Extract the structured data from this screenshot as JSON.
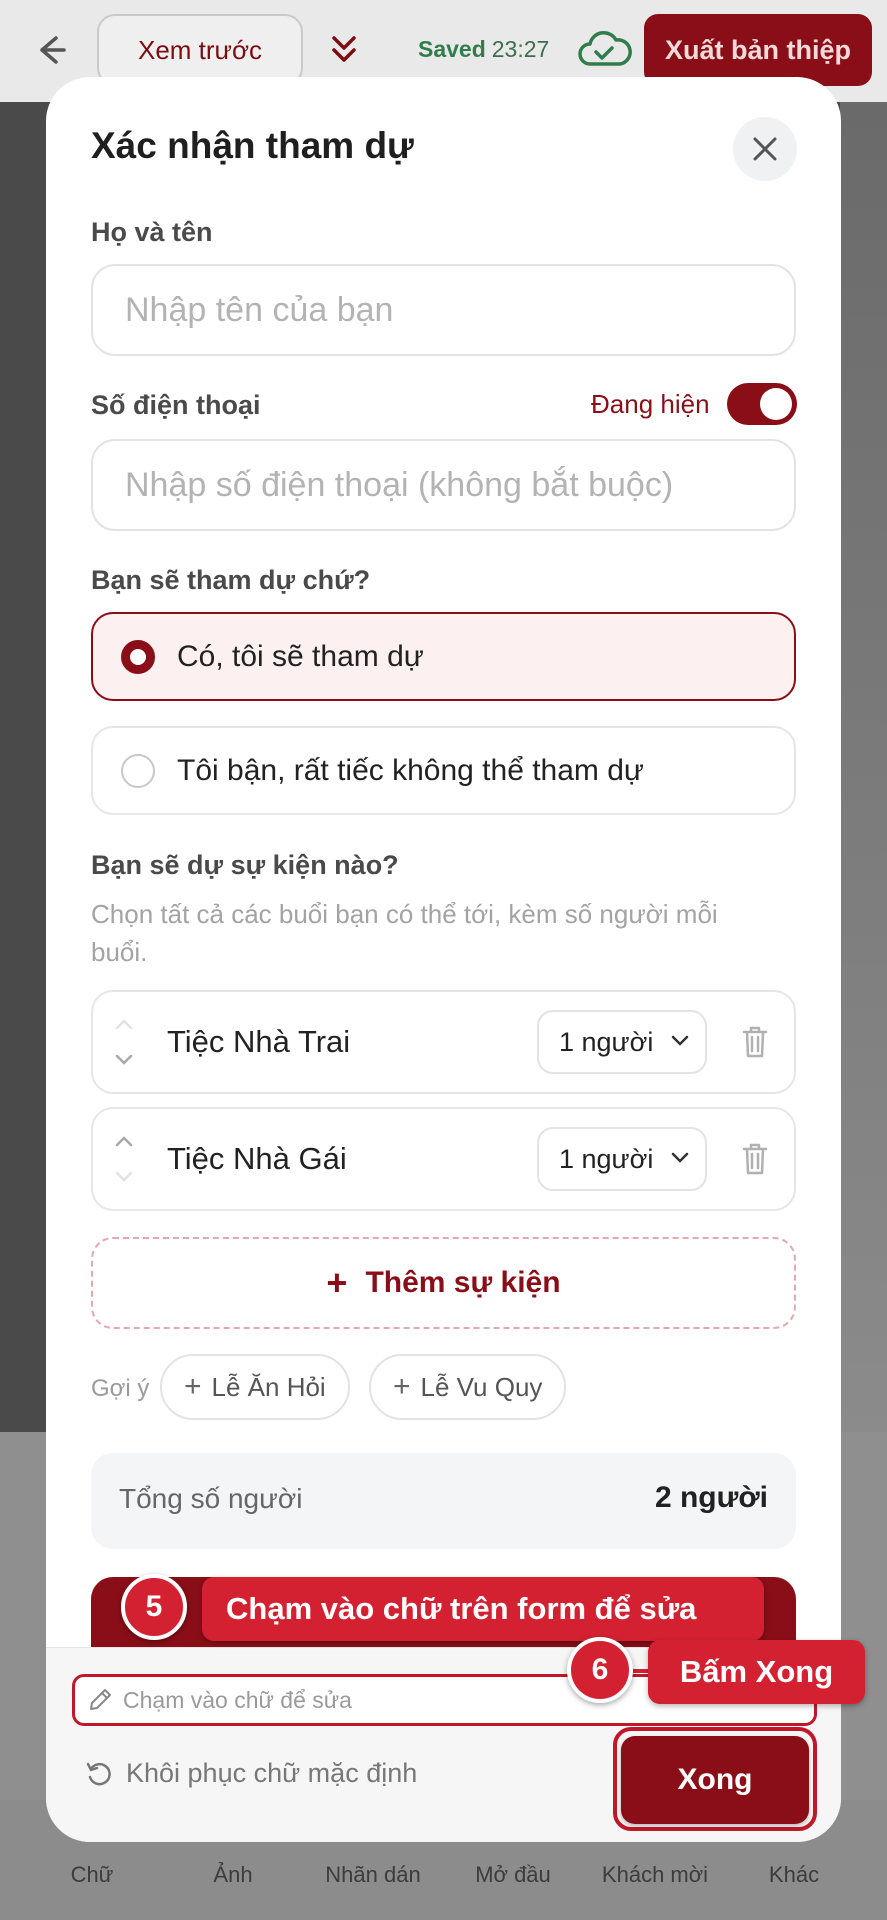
{
  "topbar": {
    "preview_label": "Xem trước",
    "saved_label": "Saved",
    "saved_time": "23:27",
    "export_label": "Xuất bản thiệp"
  },
  "bottom_nav": [
    "Chữ",
    "Ảnh",
    "Nhãn dán",
    "Mở đầu",
    "Khách mời",
    "Khác"
  ],
  "modal": {
    "title": "Xác nhận tham dự",
    "name_label": "Họ và tên",
    "name_placeholder": "Nhập tên của bạn",
    "phone_label": "Số điện thoại",
    "phone_toggle_label": "Đang hiện",
    "phone_toggle_on": true,
    "phone_placeholder": "Nhập số điện thoại (không bắt buộc)",
    "attend_label": "Bạn sẽ tham dự chứ?",
    "attend_options": [
      {
        "label": "Có, tôi sẽ tham dự",
        "selected": true
      },
      {
        "label": "Tôi bận, rất tiếc không thể tham dự",
        "selected": false
      }
    ],
    "events_label": "Bạn sẽ dự sự kiện nào?",
    "events_hint": "Chọn tất cả các buổi bạn có thể tới, kèm số người mỗi buổi.",
    "events": [
      {
        "name": "Tiệc Nhà Trai",
        "count": "1 người"
      },
      {
        "name": "Tiệc Nhà Gái",
        "count": "1 người"
      }
    ],
    "add_event_label": "Thêm sự kiện",
    "suggestions_label": "Gợi ý",
    "suggestions": [
      "Lễ Ăn Hỏi",
      "Lễ Vu Quy"
    ],
    "total_label": "Tổng số người",
    "total_value": "2 người"
  },
  "footer": {
    "text_edit_placeholder": "Chạm vào chữ để sửa",
    "restore_label": "Khôi phục chữ mặc định",
    "done_label": "Xong"
  },
  "annotations": [
    {
      "number": "5",
      "text": "Chạm vào chữ trên form để sửa"
    },
    {
      "number": "6",
      "text": "Bấm Xong"
    }
  ],
  "colors": {
    "accent": "#8a0e17",
    "annotation": "#d42131",
    "saved_green": "#2e7d4a"
  }
}
